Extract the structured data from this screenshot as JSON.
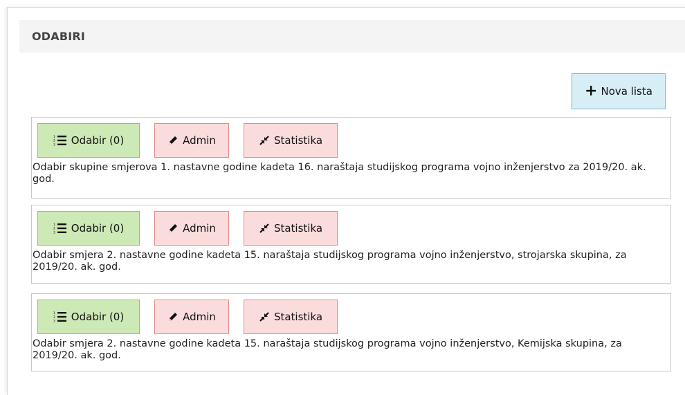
{
  "panel": {
    "title": "ODABIRI"
  },
  "toolbar": {
    "new_list_label": "Nova lista"
  },
  "cards": [
    {
      "odabir_label": "Odabir (0)",
      "admin_label": "Admin",
      "stat_label": "Statistika",
      "description": "Odabir skupine smjerova 1. nastavne godine kadeta 16. naraštaja studijskog programa vojno inženjerstvo za 2019/20. ak. god."
    },
    {
      "odabir_label": "Odabir (0)",
      "admin_label": "Admin",
      "stat_label": "Statistika",
      "description": "Odabir smjera 2. nastavne godine kadeta 15. naraštaja studijskog programa vojno inženjerstvo, strojarska skupina, za 2019/20. ak. god."
    },
    {
      "odabir_label": "Odabir (0)",
      "admin_label": "Admin",
      "stat_label": "Statistika",
      "description": "Odabir smjera 2. nastavne godine kadeta 15. naraštaja studijskog programa vojno inženjerstvo, Kemijska skupina, za 2019/20. ak. god."
    }
  ],
  "icons": {
    "new_list": "plus-icon",
    "odabir": "list-ol-icon",
    "admin": "pencil-icon",
    "stat": "compress-icon"
  },
  "colors": {
    "odabir_bg": "#cde9b5",
    "admin_bg": "#fbdcdc",
    "new_list_bg": "#d8eef7"
  }
}
